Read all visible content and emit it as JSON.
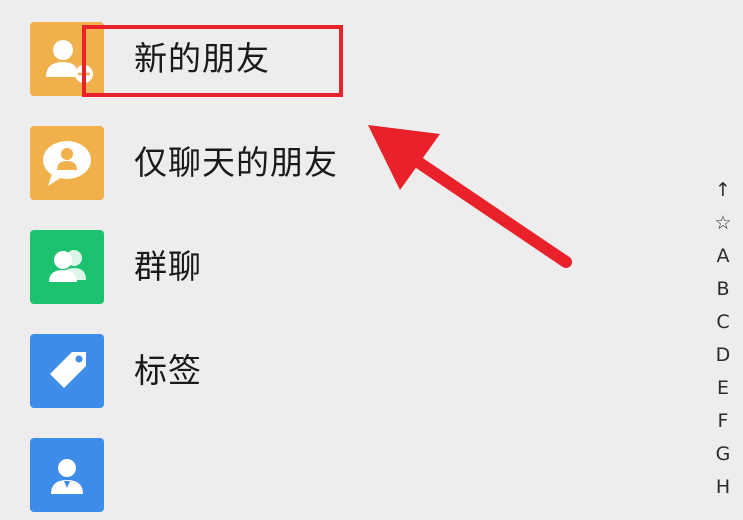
{
  "contacts_menu": {
    "items": [
      {
        "label": "新的朋友",
        "icon": "new-friend-icon",
        "color": "#f0b04c"
      },
      {
        "label": "仅聊天的朋友",
        "icon": "chat-only-friend-icon",
        "color": "#f0b04c"
      },
      {
        "label": "群聊",
        "icon": "group-chat-icon",
        "color": "#1dc270"
      },
      {
        "label": "标签",
        "icon": "tag-icon",
        "color": "#3d8ce8"
      },
      {
        "label": "",
        "icon": "official-account-icon",
        "color": "#3d8ce8"
      }
    ]
  },
  "index_bar": {
    "items": [
      "↑",
      "☆",
      "A",
      "B",
      "C",
      "D",
      "E",
      "F",
      "G",
      "H"
    ]
  },
  "annotation": {
    "box_color": "#e8212a",
    "arrow_color": "#e8212a"
  }
}
